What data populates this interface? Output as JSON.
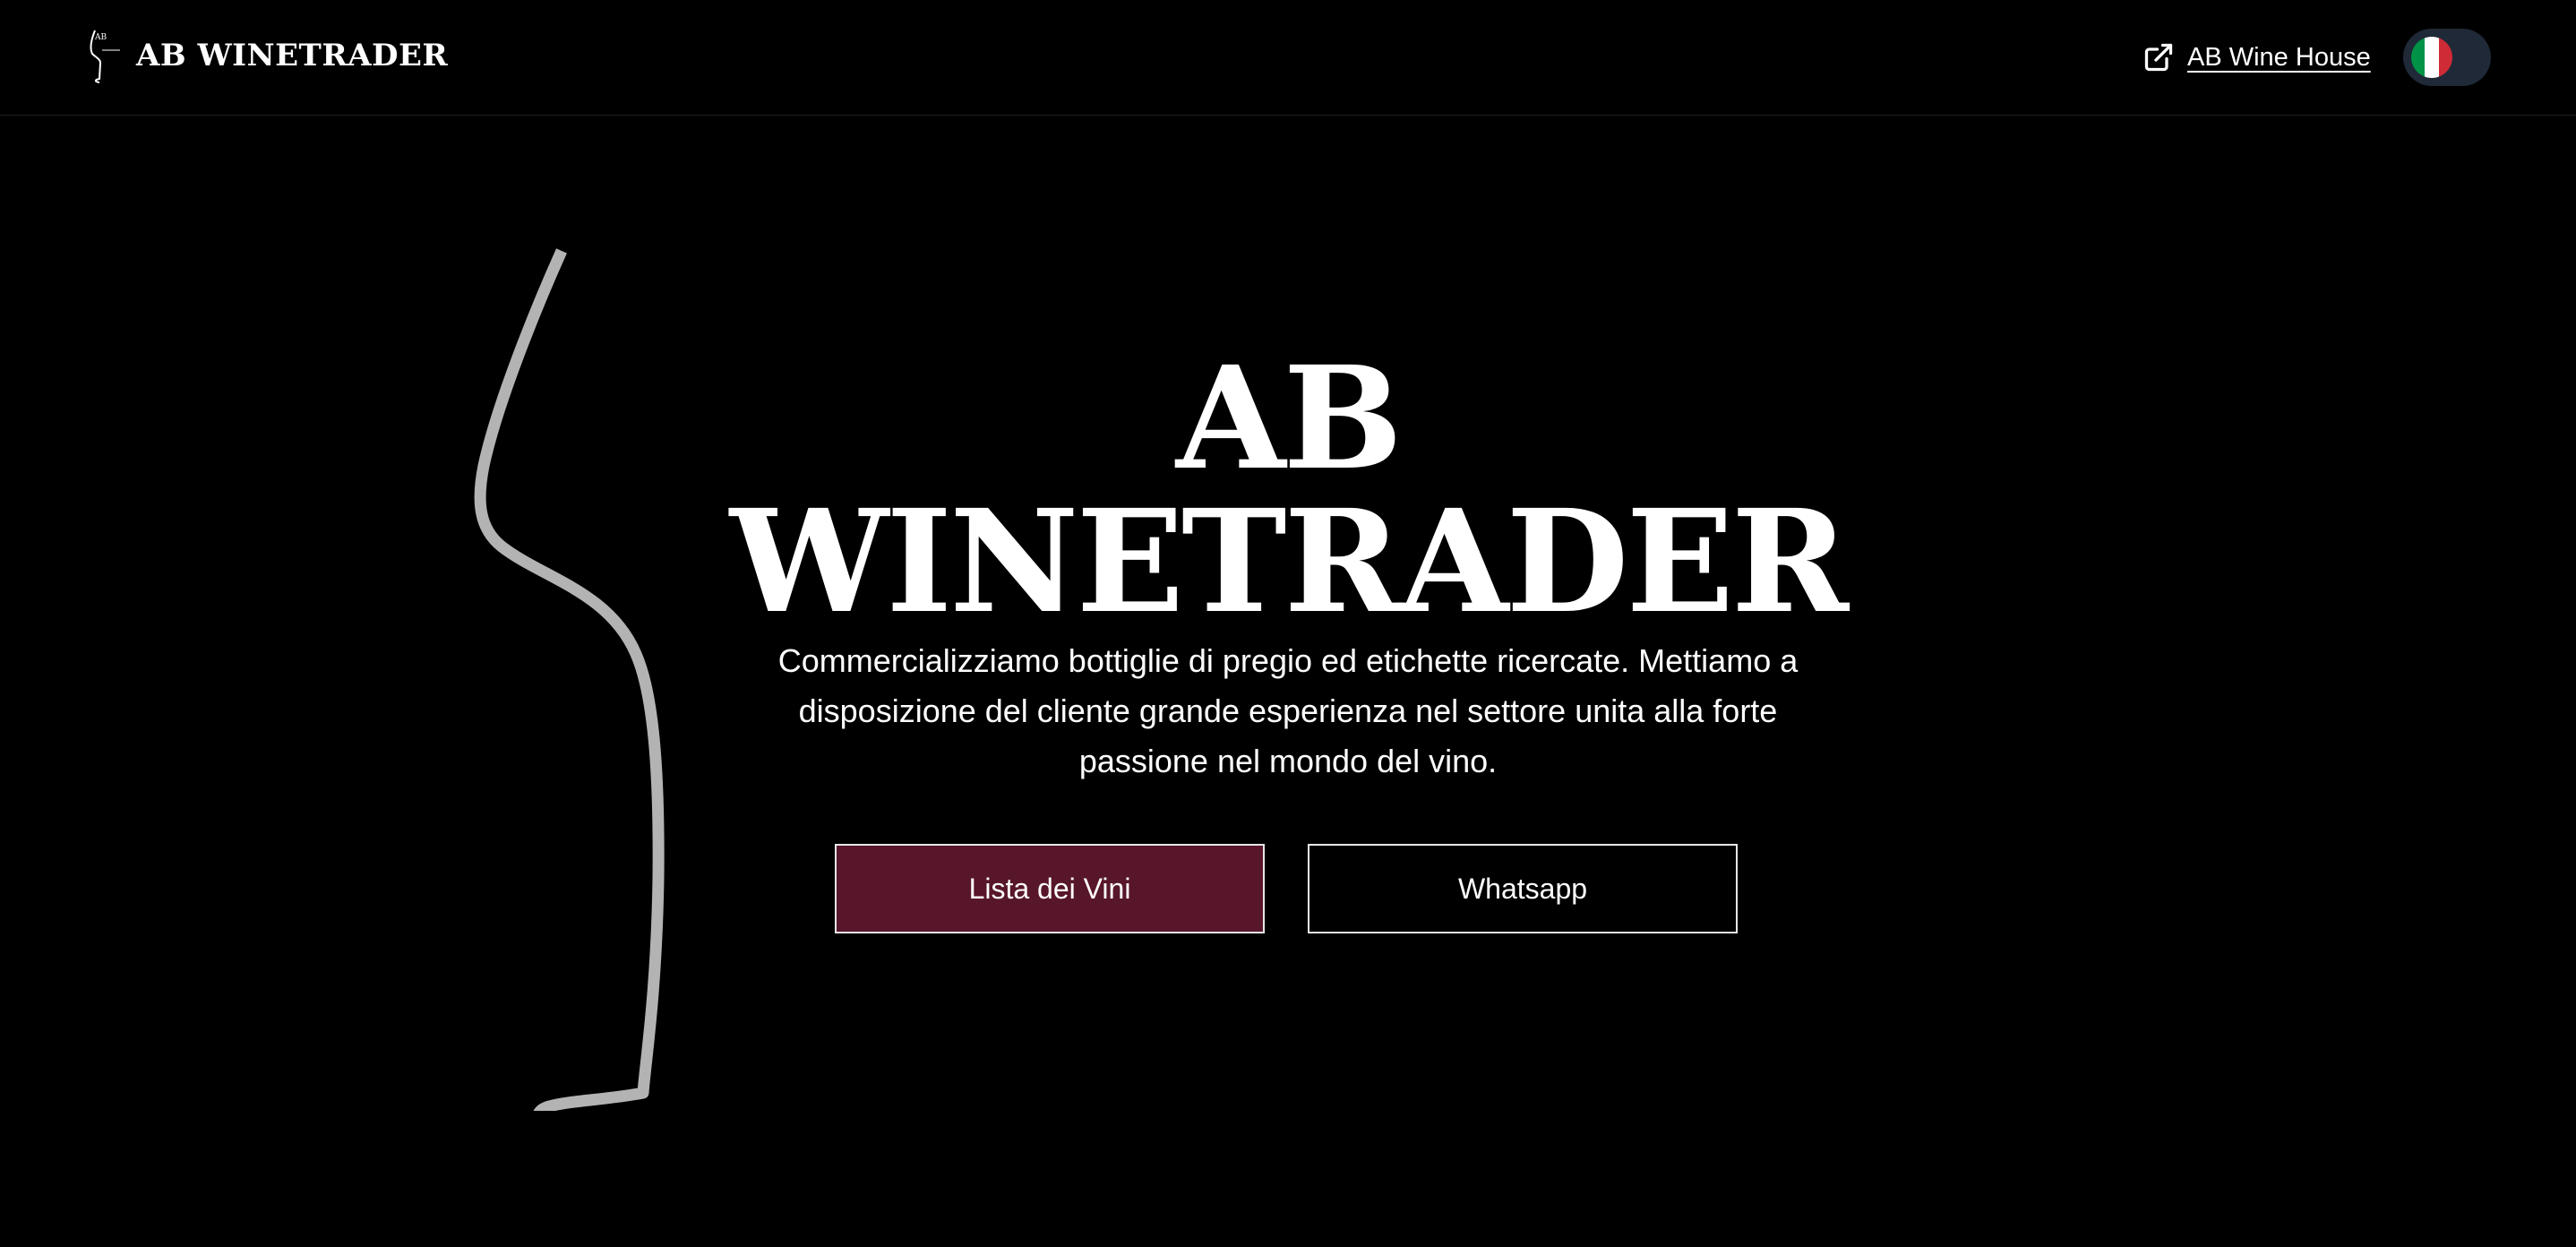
{
  "header": {
    "brand_name": "AB WINETRADER",
    "logo_icon": "wine-glass-logo-icon",
    "external_link_icon": "external-link-icon",
    "external_link_label": "AB Wine House",
    "language_toggle": {
      "current_language_flag": "italy-flag-icon",
      "flag_colors": [
        "#009246",
        "#ffffff",
        "#ce2b37"
      ]
    }
  },
  "hero": {
    "title_line1": "AB",
    "title_line2": "WINETRADER",
    "description": "Commercializziamo bottiglie di pregio ed etichette ricercate. Mettiamo a disposizione del cliente grande esperienza nel settore unita alla forte passione nel mondo del vino.",
    "illustration_icon": "wine-glass-outline-icon",
    "primary_button_label": "Lista dei Vini",
    "secondary_button_label": "Whatsapp"
  },
  "colors": {
    "background": "#000000",
    "accent": "#58162a",
    "text": "#ffffff",
    "illustration": "#b3b3b3"
  }
}
